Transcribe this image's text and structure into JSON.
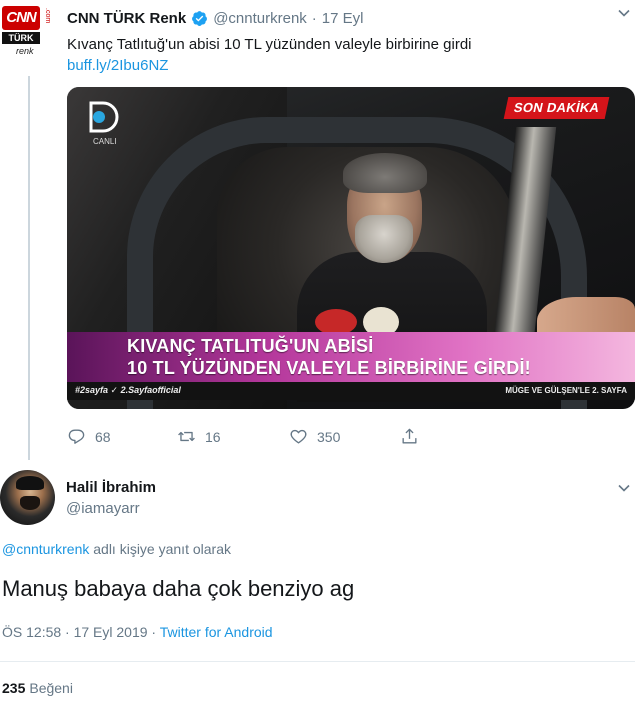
{
  "tweet": {
    "author_name": "CNN TÜRK Renk",
    "handle": "@cnnturkrenk",
    "separator": "·",
    "date": "17 Eyl",
    "text": "Kıvanç Tatlıtuğ'un abisi 10 TL yüzünden valeyle birbirine girdi",
    "link": "buff.ly/2Ibu6NZ",
    "avatar": {
      "brand": "CNN",
      "sub": "TÜRK",
      "tag": "renk",
      "side": ".com"
    },
    "media": {
      "channel_caption": "CANLI",
      "breaking_label": "SON DAKİKA",
      "banner_line1": "KIVANÇ TATLITUĞ'UN ABİSİ",
      "banner_line2": "10 TL YÜZÜNDEN VALEYLE BİRBİRİNE GİRDİ!",
      "strip_left": "#2sayfa  ✓  2.Sayfaofficial",
      "strip_right": "MÜGE VE GÜLŞEN'LE 2. SAYFA"
    },
    "actions": {
      "replies": "68",
      "retweets": "16",
      "likes": "350"
    }
  },
  "reply": {
    "author_name": "Halil İbrahim",
    "handle": "@iamayarr",
    "replying_mention": "@cnnturkrenk",
    "replying_suffix": " adlı kişiye yanıt olarak",
    "text": "Manuş babaya daha çok benziyo ag",
    "time": "ÖS 12:58 · 17 Eyl 2019 · ",
    "source": "Twitter for Android",
    "likes_count": "235",
    "likes_label": "Beğeni"
  },
  "colors": {
    "link_blue": "#1b95e0",
    "muted_gray": "#657786",
    "text_dark": "#14171a",
    "cnn_red": "#cc0000",
    "breaking_red": "#d4141a"
  },
  "icons": [
    "verified-badge-icon",
    "chevron-down-icon",
    "reply-icon",
    "retweet-icon",
    "like-icon",
    "share-icon"
  ]
}
